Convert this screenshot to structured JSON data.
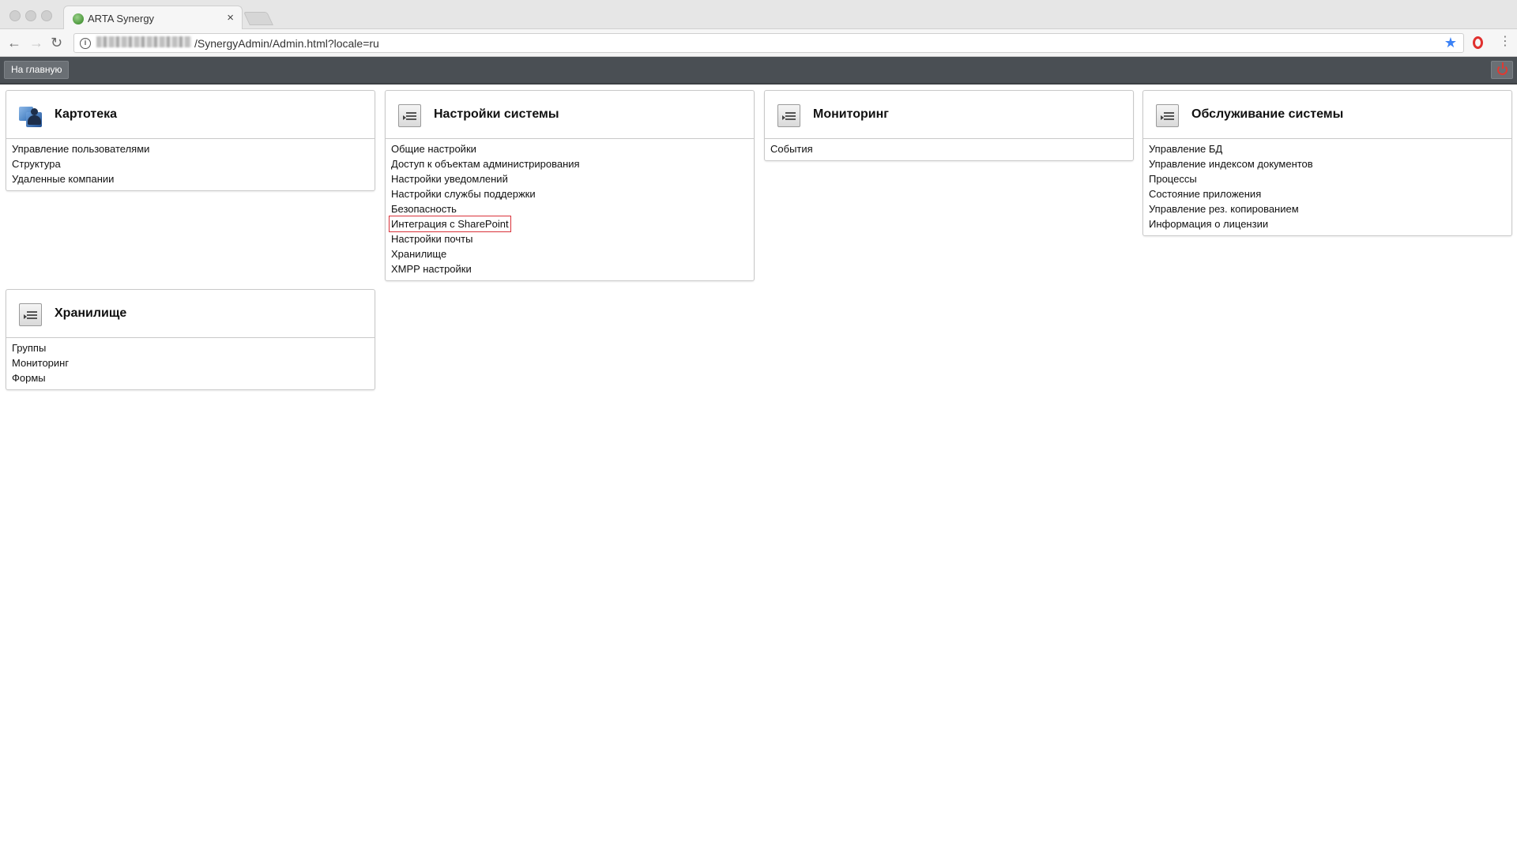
{
  "browser": {
    "tab_title": "ARTA Synergy",
    "tab_close": "×",
    "url_path": "/SynergyAdmin/Admin.html?locale=ru",
    "back": "←",
    "forward": "→",
    "reload": "↻",
    "info": "i",
    "star": "★",
    "menu": "⋮"
  },
  "header": {
    "home_label": "На главную"
  },
  "panels": {
    "kartoteka": {
      "title": "Картотека",
      "icon": "users-icon",
      "items": [
        "Управление пользователями",
        "Структура",
        "Удаленные компании"
      ]
    },
    "settings": {
      "title": "Настройки системы",
      "icon": "document-list-icon",
      "items": [
        "Общие настройки",
        "Доступ к объектам администрирования",
        "Настройки уведомлений",
        "Настройки службы поддержки",
        "Безопасность",
        "Интеграция с SharePoint",
        "Настройки почты",
        "Хранилище",
        "XMPP настройки"
      ]
    },
    "monitoring": {
      "title": "Мониторинг",
      "icon": "document-list-icon",
      "items": [
        "События"
      ]
    },
    "maintenance": {
      "title": "Обслуживание системы",
      "icon": "document-list-icon",
      "items": [
        "Управление БД",
        "Управление индексом документов",
        "Процессы",
        "Состояние приложения",
        "Управление рез. копированием",
        "Информация о лицензии"
      ]
    },
    "storage": {
      "title": "Хранилище",
      "icon": "document-list-icon",
      "items": [
        "Группы",
        "Мониторинг",
        "Формы"
      ]
    }
  },
  "colors": {
    "header_bg": "#4a4f54",
    "focus_outline": "#d9323a",
    "power_icon": "#e03a32",
    "star": "#3b82f6"
  }
}
